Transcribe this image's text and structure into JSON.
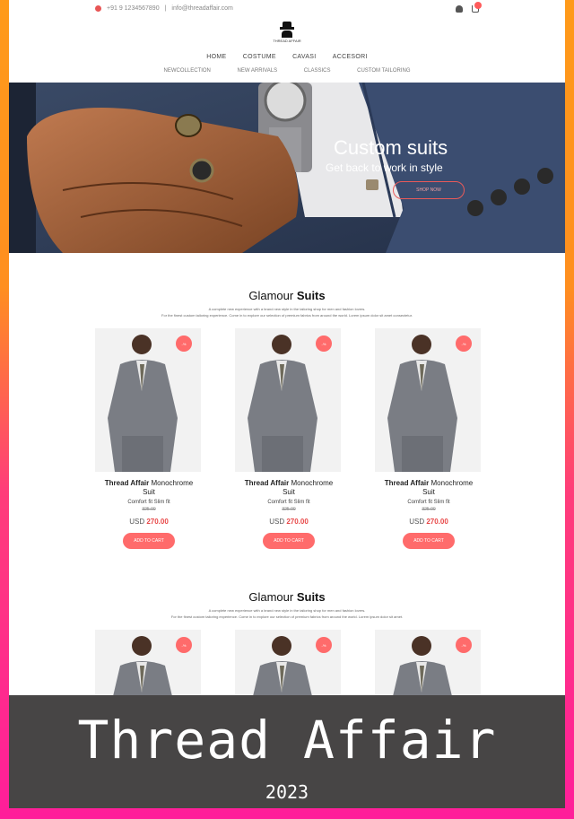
{
  "topbar": {
    "phone": "+91 9 1234567890",
    "email": "info@threadaffair.com"
  },
  "logo": {
    "text": "THREAD AFFAIR"
  },
  "nav": {
    "items": [
      "HOME",
      "COSTUME",
      "CAVASI",
      "ACCESORI"
    ],
    "sub_items": [
      "NEWCOLLECTION",
      "NEW ARRIVALS",
      "CLASSICS",
      "CUSTOM TAILORING"
    ]
  },
  "hero": {
    "title": "Custom suits",
    "subtitle": "Get back to work in style",
    "button": "SHOP NOW"
  },
  "sections": [
    {
      "title_plain": "Glamour ",
      "title_bold": "Suits",
      "desc1": "A complete new experience with a brand new style in the tailoring shop for men and fashion lovers.",
      "desc2": "For the finest custom tailoring experience. Come in to explore our selection of premium fabrics from around the world. Lorem ipsum dolor sit amet consectetur.",
      "products": [
        {
          "badge": "-%",
          "name_bold": "Thread Affair",
          "name_plain": " Monochrome",
          "name2": "Suit",
          "sub": "Comfort fit Slim fit",
          "old": "325.00",
          "currency": "USD ",
          "price": "270.00",
          "button": "ADD TO CART"
        },
        {
          "badge": "-%",
          "name_bold": "Thread Affair",
          "name_plain": " Monochrome",
          "name2": "Suit",
          "sub": "Comfort fit Slim fit",
          "old": "325.00",
          "currency": "USD ",
          "price": "270.00",
          "button": "ADD TO CART"
        },
        {
          "badge": "-%",
          "name_bold": "Thread Affair",
          "name_plain": " Monochrome",
          "name2": "Suit",
          "sub": "Comfort fit Slim fit",
          "old": "325.00",
          "currency": "USD ",
          "price": "270.00",
          "button": "ADD TO CART"
        }
      ]
    },
    {
      "title_plain": "Glamour ",
      "title_bold": "Suits",
      "desc1": "A complete new experience with a brand new style in the tailoring shop for men and fashion lovers.",
      "desc2": "For the finest custom tailoring experience. Come in to explore our selection of premium fabrics from around the world. Lorem ipsum dolor sit amet.",
      "products": [
        {
          "badge": "-%"
        },
        {
          "badge": "-%"
        },
        {
          "badge": "-%"
        }
      ]
    }
  ],
  "banner": {
    "title": "Thread Affair",
    "year": "2023"
  },
  "colors": {
    "accent": "#ff6b6b",
    "banner_bg": "#474545",
    "frame_top": "#ff9a1a",
    "frame_bottom": "#ff1e9a"
  }
}
